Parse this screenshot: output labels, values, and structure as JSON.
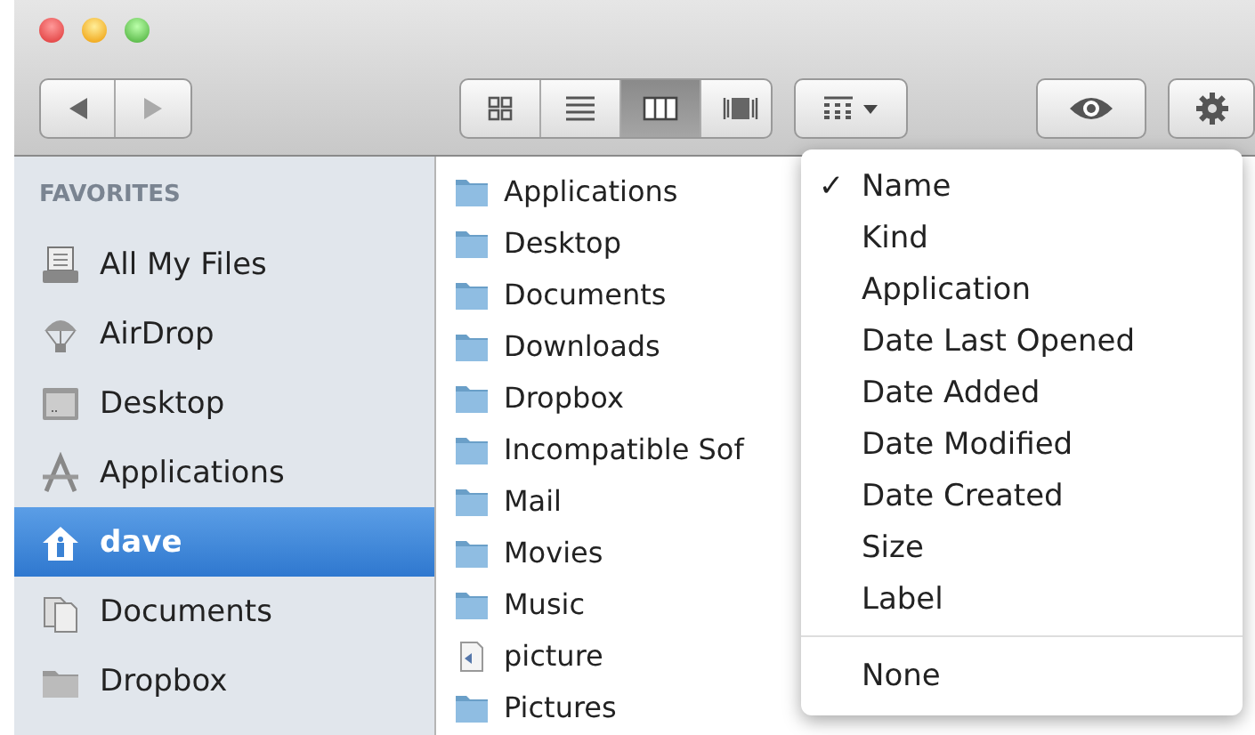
{
  "toolbar": {
    "view_buttons": [
      {
        "selected": false
      },
      {
        "selected": false
      },
      {
        "selected": true
      },
      {
        "selected": false
      }
    ]
  },
  "sidebar": {
    "heading": "FAVORITES",
    "items": [
      {
        "label": "All My Files",
        "kind": "files",
        "selected": false
      },
      {
        "label": "AirDrop",
        "kind": "airdrop",
        "selected": false
      },
      {
        "label": "Desktop",
        "kind": "desktop",
        "selected": false
      },
      {
        "label": "Applications",
        "kind": "apps",
        "selected": false
      },
      {
        "label": "dave",
        "kind": "home",
        "selected": true
      },
      {
        "label": "Documents",
        "kind": "docs",
        "selected": false
      },
      {
        "label": "Dropbox",
        "kind": "folder",
        "selected": false
      }
    ]
  },
  "files": [
    {
      "name": "Applications",
      "kind": "folder"
    },
    {
      "name": "Desktop",
      "kind": "folder"
    },
    {
      "name": "Documents",
      "kind": "folder"
    },
    {
      "name": "Downloads",
      "kind": "folder"
    },
    {
      "name": "Dropbox",
      "kind": "folder"
    },
    {
      "name": "Incompatible Sof",
      "kind": "folder"
    },
    {
      "name": "Mail",
      "kind": "folder"
    },
    {
      "name": "Movies",
      "kind": "folder"
    },
    {
      "name": "Music",
      "kind": "folder"
    },
    {
      "name": "picture",
      "kind": "file"
    },
    {
      "name": "Pictures",
      "kind": "folder"
    }
  ],
  "arrange_menu": {
    "check_mark": "✓",
    "groups": [
      [
        {
          "label": "Name",
          "selected": true
        },
        {
          "label": "Kind",
          "selected": false
        },
        {
          "label": "Application",
          "selected": false
        },
        {
          "label": "Date Last Opened",
          "selected": false
        },
        {
          "label": "Date Added",
          "selected": false
        },
        {
          "label": "Date Modified",
          "selected": false
        },
        {
          "label": "Date Created",
          "selected": false
        },
        {
          "label": "Size",
          "selected": false
        },
        {
          "label": "Label",
          "selected": false
        }
      ],
      [
        {
          "label": "None",
          "selected": false
        }
      ]
    ]
  }
}
